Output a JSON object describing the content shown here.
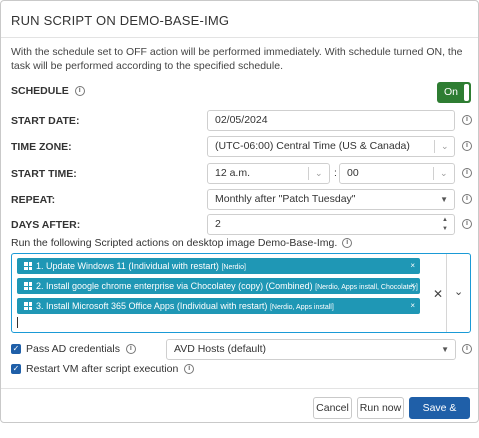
{
  "dialog": {
    "title": "RUN SCRIPT ON DEMO-BASE-IMG",
    "description": "With the schedule set to OFF action will be performed immediately. With schedule turned ON, the task will be performed according to the specified schedule."
  },
  "schedule": {
    "label": "SCHEDULE",
    "toggle": "On"
  },
  "start_date": {
    "label": "START DATE:",
    "value": "02/05/2024"
  },
  "time_zone": {
    "label": "TIME ZONE:",
    "value": "(UTC-06:00) Central Time (US & Canada)"
  },
  "start_time": {
    "label": "START TIME:",
    "hour": "12 a.m.",
    "separator": ":",
    "minute": "00"
  },
  "repeat": {
    "label": "REPEAT:",
    "value": "Monthly after \"Patch Tuesday\""
  },
  "days_after": {
    "label": "DAYS AFTER:",
    "value": "2"
  },
  "scripted_actions": {
    "label": "Run the following Scripted actions on desktop image Demo-Base-Img.",
    "items": [
      {
        "text": "1. Update Windows 11 (Individual with restart)",
        "tags": "[Nerdio]"
      },
      {
        "text": "2. Install google chrome enterprise via Chocolatey (copy) (Combined)",
        "tags": "[Nerdio, Apps install, Chocolatey]"
      },
      {
        "text": "3. Install Microsoft 365 Office Apps (Individual with restart)",
        "tags": "[Nerdio, Apps install]"
      }
    ],
    "remove": "×",
    "clear": "✕",
    "expand": "⌄"
  },
  "pass_ad": {
    "label": "Pass AD credentials",
    "select": "AVD Hosts (default)"
  },
  "restart_vm": {
    "label": "Restart VM after script execution"
  },
  "buttons": {
    "cancel": "Cancel",
    "run_now": "Run now",
    "save_close": "Save & close"
  },
  "icons": {
    "info": "i",
    "check": "✓",
    "caret_down": "▼",
    "chevron_down": "⌄",
    "close": "×"
  },
  "colors": {
    "toggle_on": "#2e7d32",
    "chip": "#1f97b5",
    "primary": "#1f5fa8",
    "focus": "#1a9ad6"
  }
}
